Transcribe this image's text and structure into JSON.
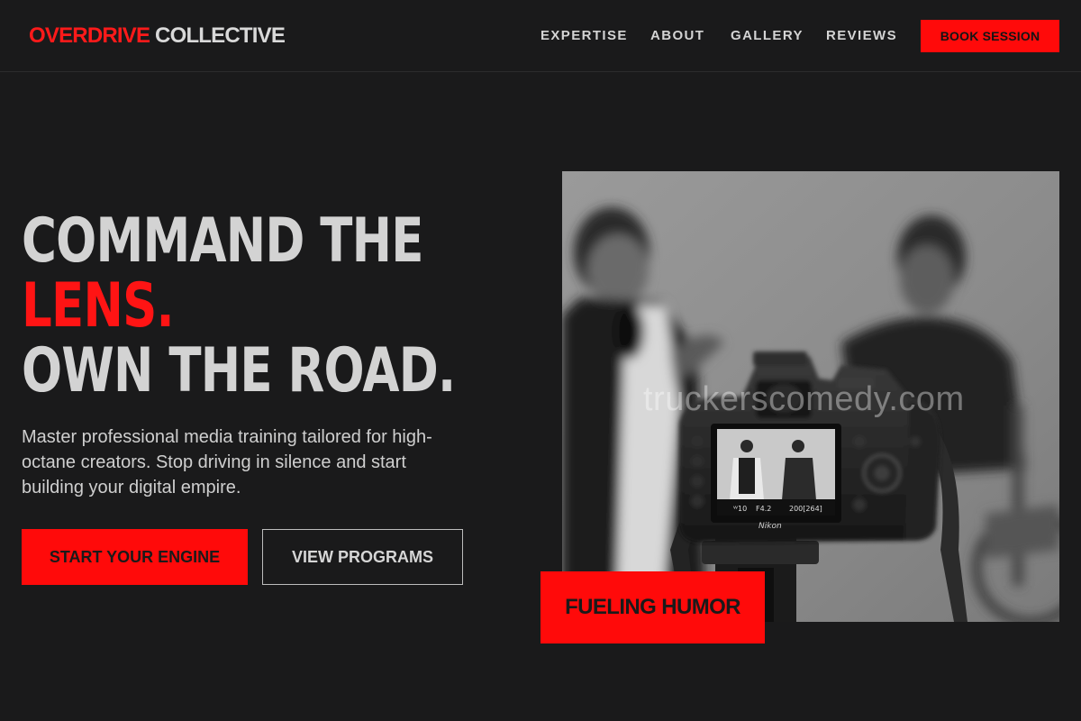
{
  "brand": {
    "part1": "OVERDRIVE",
    "part2": "COLLECTIVE",
    "accent_color": "#ff0a0a"
  },
  "nav": {
    "items": [
      {
        "label": "EXPERTISE"
      },
      {
        "label": "ABOUT"
      },
      {
        "label": "GALLERY"
      },
      {
        "label": "REVIEWS"
      }
    ],
    "cta_label": "BOOK SESSION"
  },
  "hero": {
    "headline_line1": "COMMAND THE",
    "headline_line2": "LENS.",
    "headline_line3": "OWN THE ROAD.",
    "subtext": "Master professional media training tailored for high-octane creators. Stop driving in silence and start building your digital empire.",
    "primary_button": "START YOUR ENGINE",
    "secondary_button": "VIEW PROGRAMS",
    "image": {
      "watermark": "truckerscomedy.com",
      "camera_brand": "Nikon",
      "badge_label": "FUELING HUMOR"
    }
  },
  "colors": {
    "background": "#1a1a1b",
    "text": "#d6d6d6",
    "accent": "#ff0a0a"
  }
}
